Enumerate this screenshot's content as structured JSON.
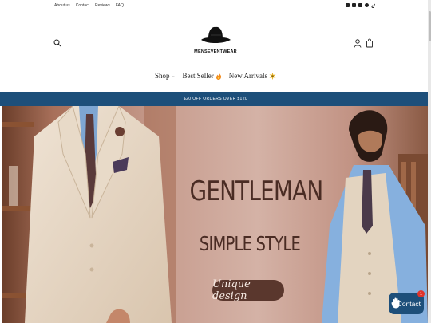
{
  "topbar": {
    "links": [
      "About us",
      "Contact",
      "Reviews",
      "FAQ"
    ],
    "socials": [
      "instagram-icon",
      "facebook-icon",
      "youtube-icon",
      "pinterest-icon",
      "tiktok-icon"
    ]
  },
  "header": {
    "brand": "MENSEVENTWEAR",
    "nav": [
      {
        "label": "Shop",
        "has_dropdown": true
      },
      {
        "label": "Best Seller",
        "emoji": "fire-icon"
      },
      {
        "label": "New Arrivals",
        "emoji": "sparkle-icon"
      }
    ]
  },
  "announcement": "$20 OFF ORDERS OVER $120",
  "hero": {
    "title": "GENTLEMAN",
    "subtitle": "SIMPLE STYLE",
    "badge": "Unique design"
  },
  "contact_widget": {
    "label": "Contact",
    "badge_count": "1"
  },
  "colors": {
    "announcement_bg": "#1d4f7a",
    "hero_bg": "#c9a89c",
    "hero_text": "#4a2c24",
    "badge_bg": "#5a372d"
  }
}
